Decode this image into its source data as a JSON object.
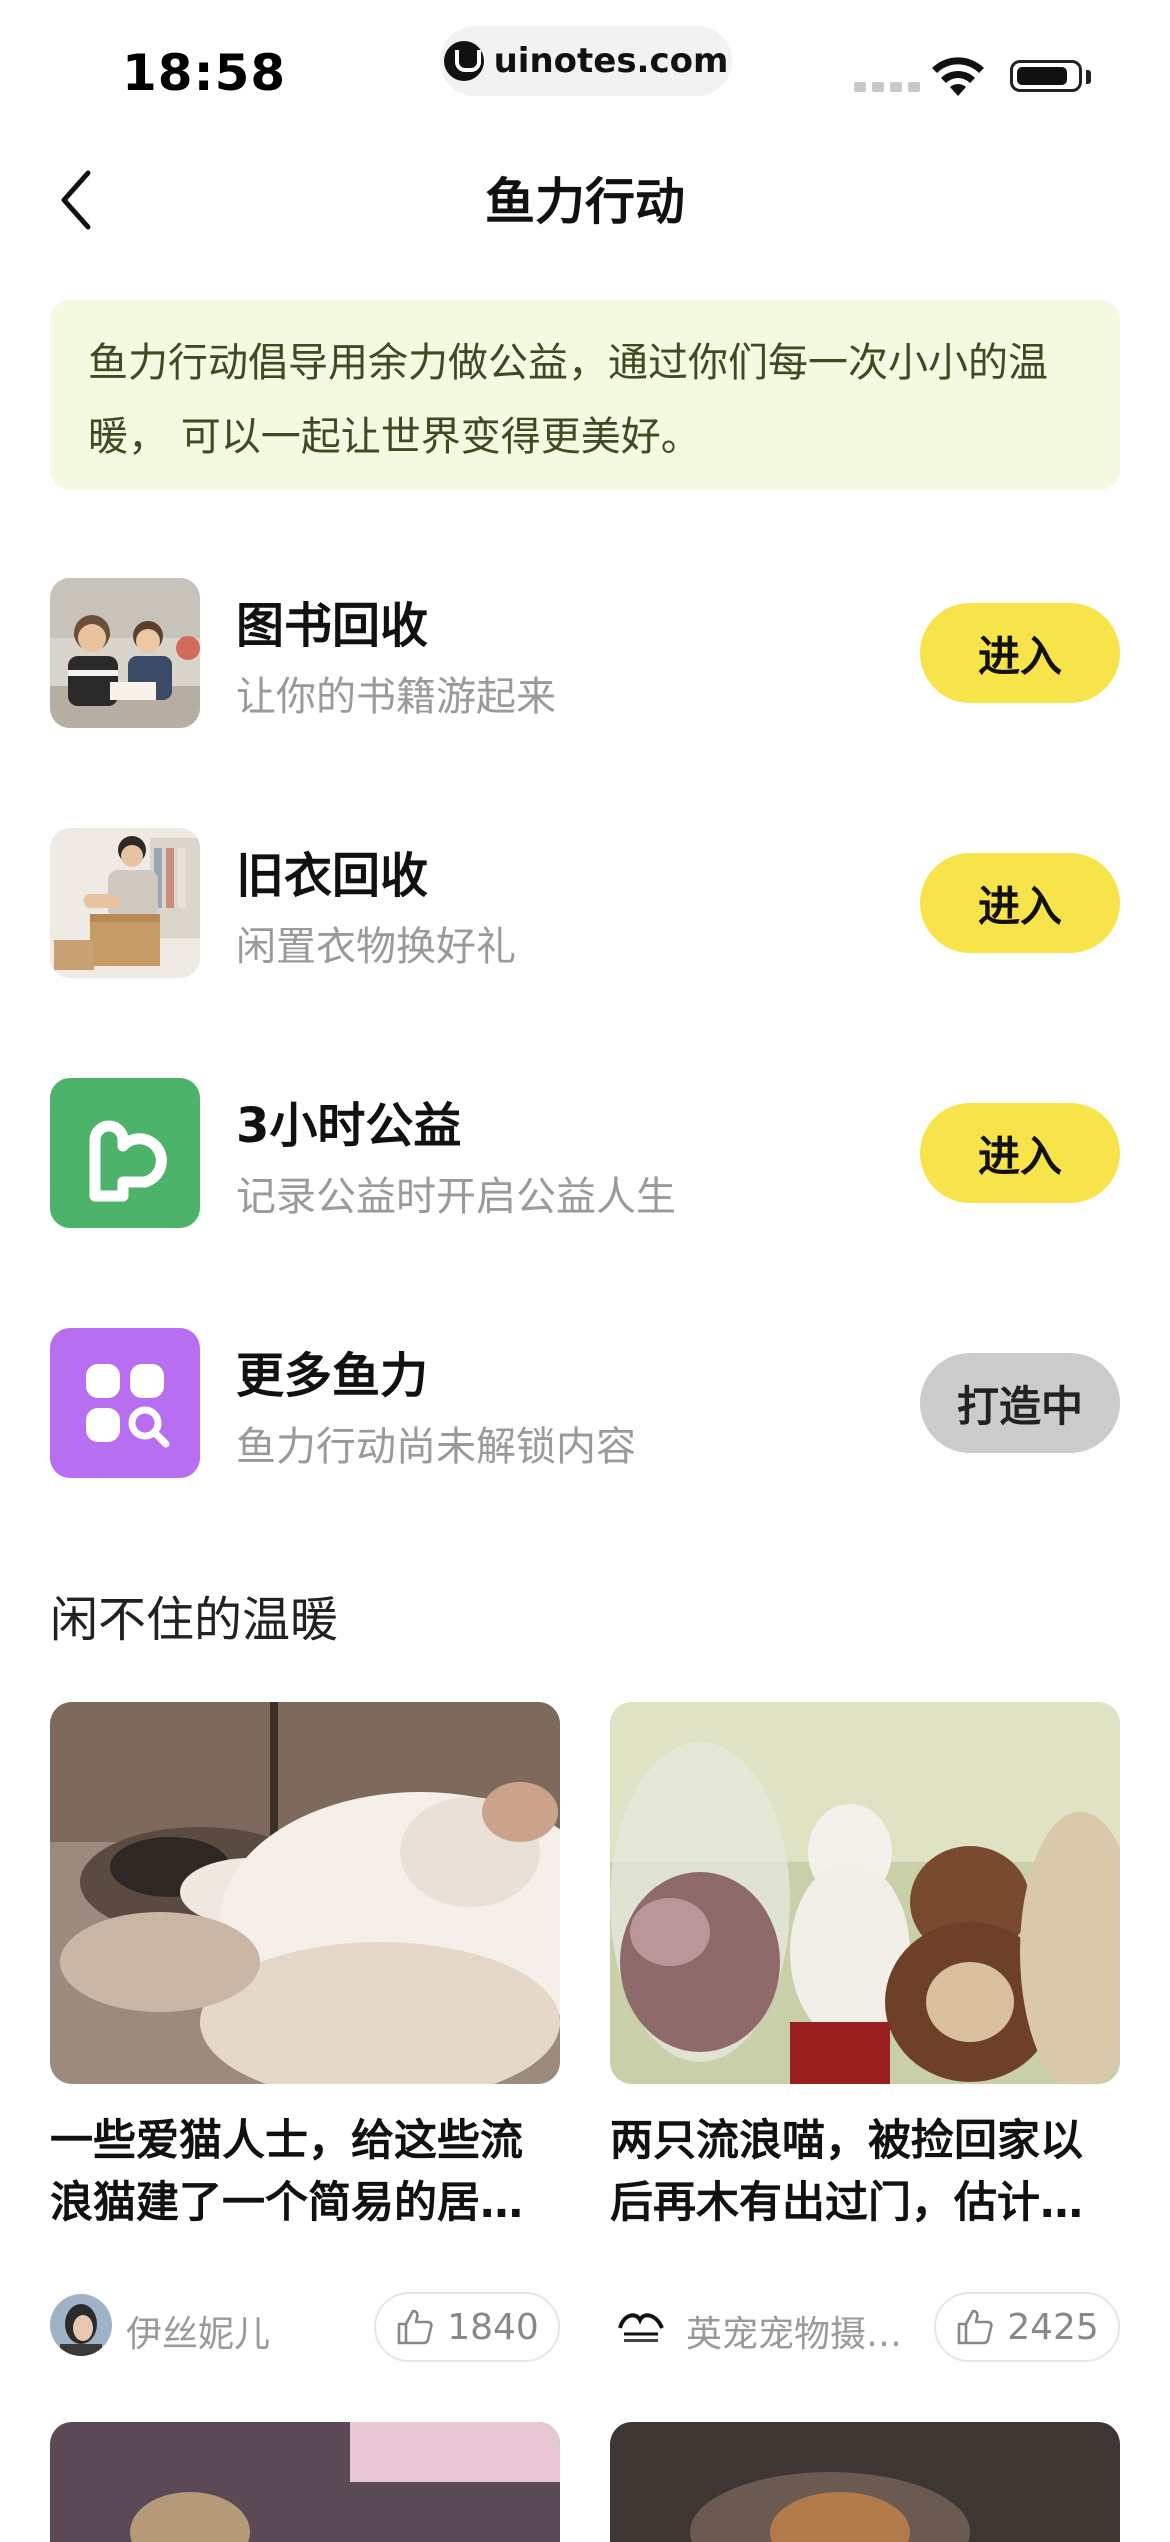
{
  "status": {
    "time": "18:58",
    "url": "uinotes.com"
  },
  "nav": {
    "title": "鱼力行动",
    "back_icon": "chevron-left-icon"
  },
  "intro": {
    "text": "鱼力行动倡导用余力做公益，通过你们每一次小小的温暖， 可以一起让世界变得更美好。"
  },
  "programs": [
    {
      "title": "图书回收",
      "subtitle": "让你的书籍游起来",
      "button": "进入",
      "icon": "book-recycle-photo"
    },
    {
      "title": "旧衣回收",
      "subtitle": "闲置衣物换好礼",
      "button": "进入",
      "icon": "clothes-recycle-photo"
    },
    {
      "title": "3小时公益",
      "subtitle": "记录公益时开启公益人生",
      "button": "进入",
      "icon": "heart-hand-icon",
      "icon_color": "#4db36b"
    },
    {
      "title": "更多鱼力",
      "subtitle": "鱼力行动尚未解锁内容",
      "button": "打造中",
      "icon": "grid-search-icon",
      "icon_color": "#b86ef0"
    }
  ],
  "section": {
    "title": "闲不住的温暖"
  },
  "feed": [
    {
      "title_line1": "一些爱猫人士，给这些流",
      "title_line2": "浪猫建了一个简易的居…",
      "author": "伊丝妮儿",
      "likes": "1840"
    },
    {
      "title_line1": "两只流浪喵，被捡回家以",
      "title_line2": "后再木有出过门，估计…",
      "author": "英宠宠物摄…",
      "likes": "2425"
    }
  ],
  "colors": {
    "accent": "#f7e34a",
    "intro_bg": "#f4fae2"
  }
}
